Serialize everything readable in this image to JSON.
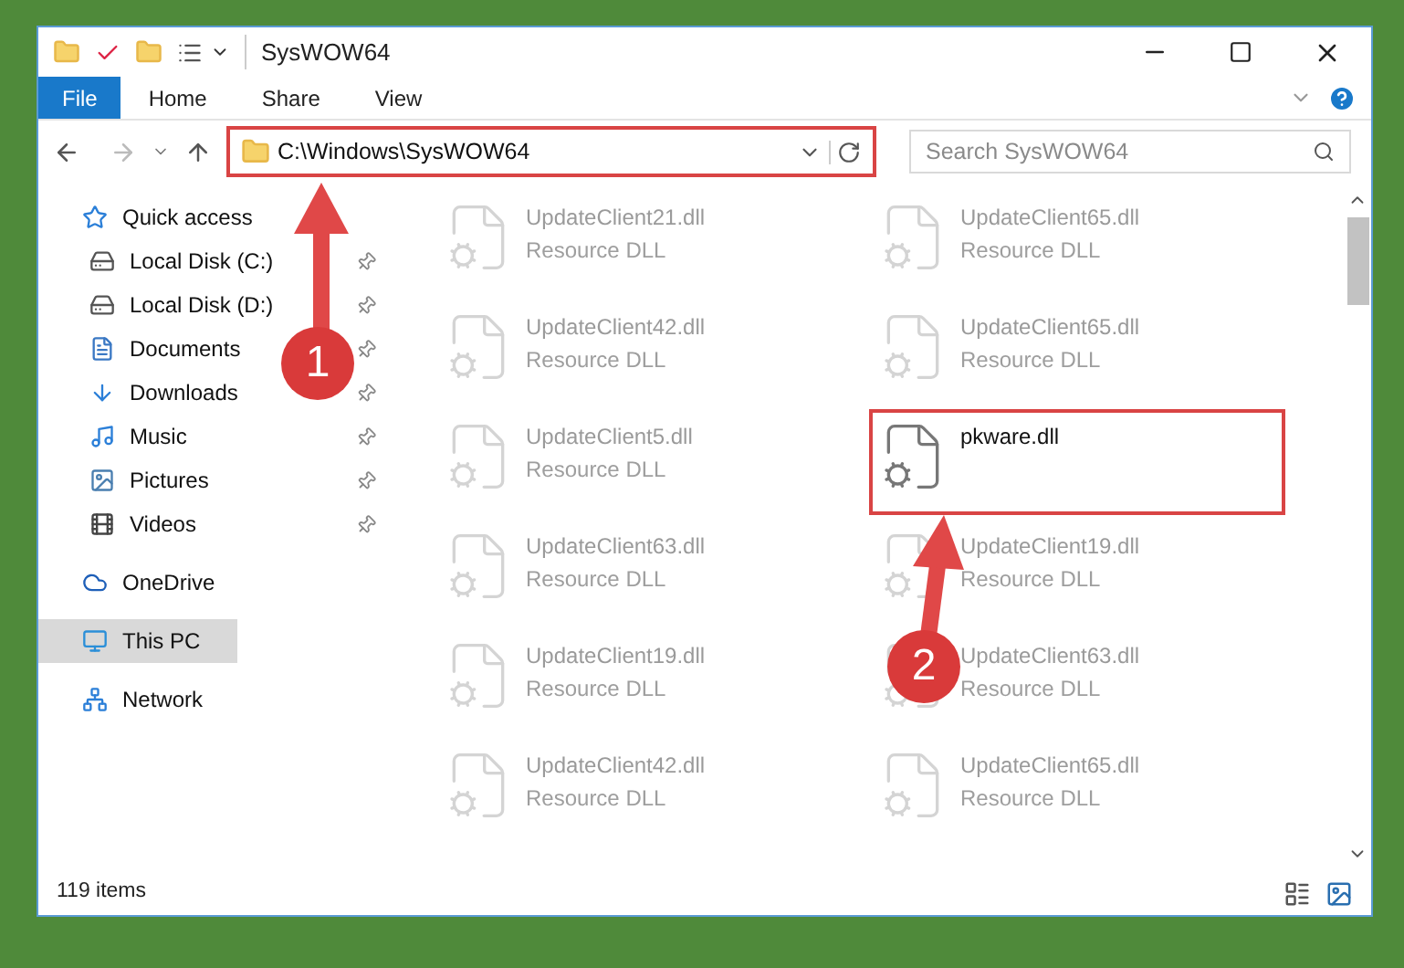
{
  "window": {
    "title": "SysWOW64"
  },
  "ribbon": {
    "tabs": [
      {
        "label": "File",
        "kind": "file"
      },
      {
        "label": "Home",
        "kind": "tab"
      },
      {
        "label": "Share",
        "kind": "tab"
      },
      {
        "label": "View",
        "kind": "tab"
      }
    ]
  },
  "address_bar": {
    "path": "C:\\Windows\\SysWOW64",
    "highlighted": true
  },
  "search": {
    "placeholder": "Search SysWOW64"
  },
  "sidebar": {
    "items": [
      {
        "label": "Quick access",
        "kind": "star",
        "selected": false,
        "children": [
          {
            "label": "Local Disk (C:)",
            "kind": "drive",
            "selected": false,
            "pinned": true
          },
          {
            "label": "Local Disk (D:)",
            "kind": "drive",
            "selected": false,
            "pinned": true
          },
          {
            "label": "Documents",
            "kind": "document",
            "selected": false,
            "pinned": true
          },
          {
            "label": "Downloads",
            "kind": "download",
            "selected": false,
            "pinned": true
          },
          {
            "label": "Music",
            "kind": "music",
            "selected": false,
            "pinned": true
          },
          {
            "label": "Pictures",
            "kind": "picture",
            "selected": false,
            "pinned": true
          },
          {
            "label": "Videos",
            "kind": "video",
            "selected": false,
            "pinned": true
          }
        ]
      },
      {
        "label": "OneDrive",
        "kind": "cloud",
        "selected": false
      },
      {
        "label": "This PC",
        "kind": "pc",
        "selected": true
      },
      {
        "label": "Network",
        "kind": "network",
        "selected": false
      }
    ]
  },
  "files": [
    {
      "name": "UpdateClient21.dll",
      "type": "Resource DLL",
      "faded": true,
      "highlighted": false
    },
    {
      "name": "UpdateClient65.dll",
      "type": "Resource DLL",
      "faded": true,
      "highlighted": false
    },
    {
      "name": "UpdateClient42.dll",
      "type": "Resource DLL",
      "faded": true,
      "highlighted": false
    },
    {
      "name": "UpdateClient65.dll",
      "type": "Resource DLL",
      "faded": true,
      "highlighted": false
    },
    {
      "name": "UpdateClient5.dll",
      "type": "Resource DLL",
      "faded": true,
      "highlighted": false
    },
    {
      "name": "pkware.dll",
      "faded": false,
      "highlighted": true
    },
    {
      "name": "UpdateClient63.dll",
      "type": "Resource DLL",
      "faded": true,
      "highlighted": false
    },
    {
      "name": "UpdateClient19.dll",
      "type": "Resource DLL",
      "faded": true,
      "highlighted": false
    },
    {
      "name": "UpdateClient19.dll",
      "type": "Resource DLL",
      "faded": true,
      "highlighted": false
    },
    {
      "name": "UpdateClient63.dll",
      "type": "Resource DLL",
      "faded": true,
      "highlighted": false
    },
    {
      "name": "UpdateClient42.dll",
      "type": "Resource DLL",
      "faded": true,
      "highlighted": false
    },
    {
      "name": "UpdateClient65.dll",
      "type": "Resource DLL",
      "faded": true,
      "highlighted": false
    }
  ],
  "status_bar": {
    "count": "119 items"
  },
  "annotations": [
    {
      "number": "1"
    },
    {
      "number": "2"
    }
  ]
}
